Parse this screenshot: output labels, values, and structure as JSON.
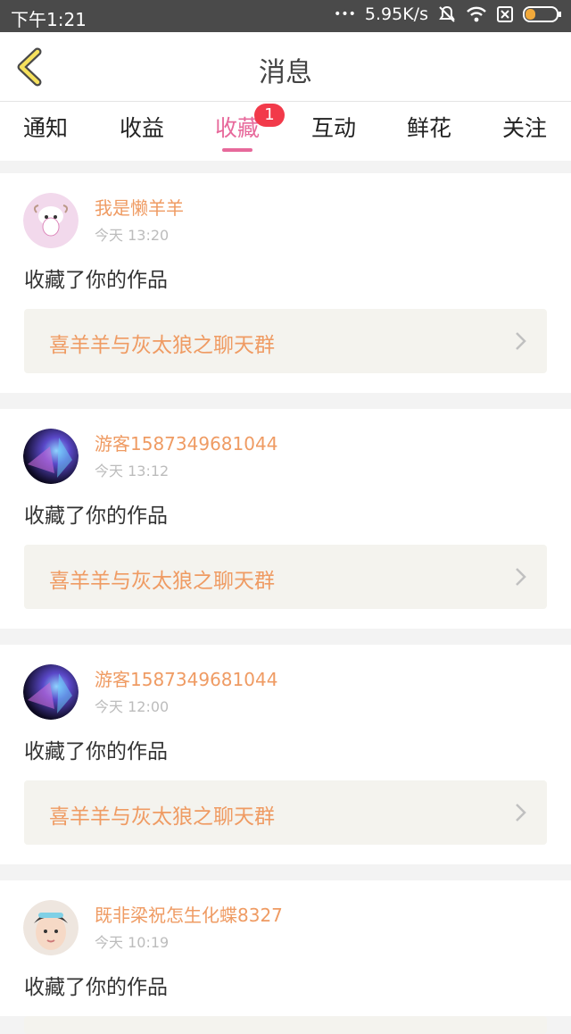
{
  "status_bar": {
    "time": "下午1:21",
    "dots": "•••",
    "speed": "5.95K/s",
    "icons": [
      "mute-icon",
      "wifi-icon",
      "sim-icon",
      "battery-icon"
    ]
  },
  "header": {
    "title": "消息",
    "back_icon": "chevron-left-icon"
  },
  "tabs": [
    {
      "label": "通知"
    },
    {
      "label": "收益"
    },
    {
      "label": "收藏",
      "active": true,
      "badge": "1"
    },
    {
      "label": "互动"
    },
    {
      "label": "鲜花"
    },
    {
      "label": "关注"
    }
  ],
  "colors": {
    "accent": "#e7699b",
    "name": "#ef9b63",
    "badge": "#f23a4a"
  },
  "items": [
    {
      "user": "我是懒羊羊",
      "time": "今天 13:20",
      "action": "收藏了你的作品",
      "work": "喜羊羊与灰太狼之聊天群"
    },
    {
      "user": "游客1587349681044",
      "time": "今天 13:12",
      "action": "收藏了你的作品",
      "work": "喜羊羊与灰太狼之聊天群"
    },
    {
      "user": "游客1587349681044",
      "time": "今天 12:00",
      "action": "收藏了你的作品",
      "work": "喜羊羊与灰太狼之聊天群"
    },
    {
      "user": "既非梁祝怎生化蝶8327",
      "time": "今天 10:19",
      "action": "收藏了你的作品",
      "work": ""
    }
  ]
}
